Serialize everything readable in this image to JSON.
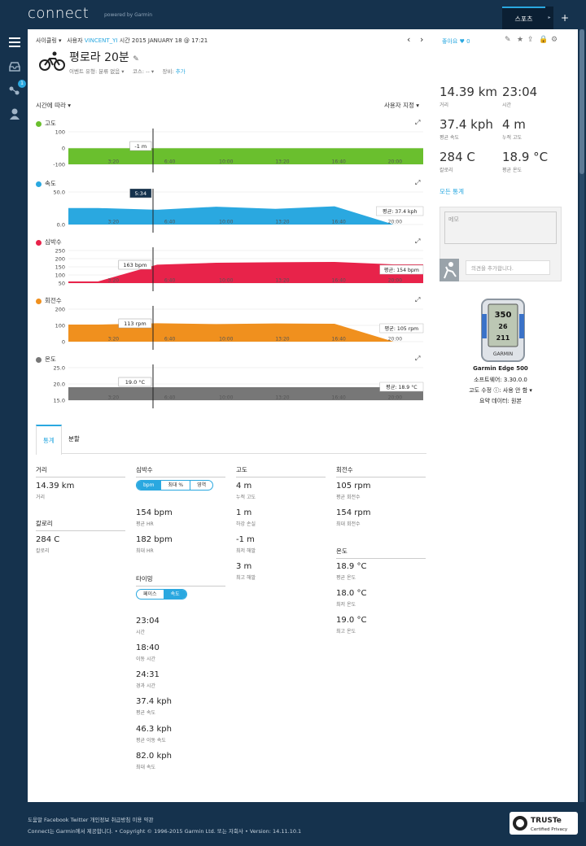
{
  "header": {
    "logo": "connect",
    "powered_by": "powered by Garmin",
    "sport_tab": "스포츠",
    "tab_menu": "▸",
    "add_tab": "+"
  },
  "leftnav": {
    "badge": "1"
  },
  "breadcrumb": {
    "activity_type": "사이클링 ▾",
    "user_label": "사용자",
    "user": "VINCENT_YI",
    "time_label": "시간",
    "date": "2015 JANUARY 18 @ 17:21"
  },
  "pager": {
    "prev": "‹",
    "next": "›"
  },
  "like": {
    "label": "좋아요",
    "count": "0"
  },
  "activity": {
    "title": "평로라 20분",
    "event_type_label": "이벤트 유형:",
    "event_type": "분류 없음 ▾",
    "course_label": "코스:",
    "course": "-- ▾",
    "gear_label": "장비:",
    "gear": "추가"
  },
  "chart_controls": {
    "time_select": "시간에 따라 ▾",
    "user_select": "사용자 지정 ▾"
  },
  "chart_data": [
    {
      "type": "area",
      "title": "고도",
      "color": "#6abf2e",
      "x": [
        "3:20",
        "6:40",
        "10:00",
        "13:20",
        "16:40",
        "20:00"
      ],
      "y": [
        -1,
        -1,
        -1,
        -1,
        -1,
        -1
      ],
      "yticks": [
        "100",
        "0",
        "-100"
      ],
      "ylim": [
        -100,
        100
      ],
      "cursor_label": "-1 m"
    },
    {
      "type": "area",
      "title": "속도",
      "color": "#2aa8e0",
      "x": [
        "3:20",
        "6:40",
        "10:00",
        "13:20",
        "16:40",
        "20:00"
      ],
      "y": [
        38,
        34,
        41,
        36,
        42,
        0
      ],
      "yticks": [
        "50.0",
        "0.0"
      ],
      "ylim": [
        0,
        75
      ],
      "cursor_label": "5:34",
      "avg_label": "평균: 37.4 kph"
    },
    {
      "type": "area",
      "title": "심박수",
      "color": "#e8234a",
      "x": [
        "3:20",
        "6:40",
        "10:00",
        "13:20",
        "16:40",
        "20:00"
      ],
      "y": [
        60,
        163,
        175,
        178,
        180,
        165
      ],
      "yticks": [
        "250",
        "200",
        "150",
        "100",
        "50"
      ],
      "ylim": [
        50,
        250
      ],
      "cursor_label": "163 bpm",
      "avg_label": "평균: 154 bpm"
    },
    {
      "type": "area",
      "title": "회전수",
      "color": "#f0901e",
      "x": [
        "3:20",
        "6:40",
        "10:00",
        "13:20",
        "16:40",
        "20:00"
      ],
      "y": [
        105,
        113,
        108,
        112,
        110,
        0
      ],
      "yticks": [
        "200",
        "100",
        "0"
      ],
      "ylim": [
        0,
        200
      ],
      "cursor_label": "113 rpm",
      "avg_label": "평균: 105 rpm"
    },
    {
      "type": "area",
      "title": "온도",
      "color": "#777777",
      "x": [
        "3:20",
        "6:40",
        "10:00",
        "13:20",
        "16:40",
        "20:00"
      ],
      "y": [
        19.0,
        19.0,
        19.0,
        19.0,
        19.0,
        19.0
      ],
      "yticks": [
        "25.0",
        "20.0",
        "15.0"
      ],
      "ylim": [
        15,
        25
      ],
      "cursor_label": "19.0 °C",
      "avg_label": "평균: 18.9 °C"
    }
  ],
  "summary": {
    "distance": {
      "value": "14.39 km",
      "label": "거리"
    },
    "time": {
      "value": "23:04",
      "label": "시간"
    },
    "avg_speed": {
      "value": "37.4 kph",
      "label": "평균 속도"
    },
    "elev_gain": {
      "value": "4 m",
      "label": "누적 고도"
    },
    "calories": {
      "value": "284 C",
      "label": "칼로리"
    },
    "avg_temp": {
      "value": "18.9 °C",
      "label": "평균 온도"
    },
    "all_stats": "모든 통계"
  },
  "notes": {
    "memo_placeholder": "메모",
    "comment_placeholder": "의견을 추가합니다."
  },
  "device": {
    "screen_top": "350",
    "screen_mid": "26",
    "screen_bot": "211",
    "brand": "GARMIN",
    "name": "Garmin Edge 500",
    "firmware": "소프트웨어: 3.30.0.0",
    "elev_correction": "고도 수정 ⓘ: 사용 안 함 ▾",
    "summary_data": "요약 데이터: 원본"
  },
  "tabs": {
    "stats": "통계",
    "splits": "분할"
  },
  "stats": {
    "distance_h": "거리",
    "distance_v": "14.39 km",
    "distance_l": "거리",
    "calories_h": "칼로리",
    "calories_v": "284 C",
    "calories_l": "칼로리",
    "hr_h": "심박수",
    "hr_toggle": [
      "bpm",
      "최대 %",
      "영역"
    ],
    "hr_avg_v": "154 bpm",
    "hr_avg_l": "평균 HR",
    "hr_max_v": "182 bpm",
    "hr_max_l": "최대 HR",
    "timing_h": "타이밍",
    "timing_toggle": [
      "페이스",
      "속도"
    ],
    "t1_v": "23:04",
    "t1_l": "시간",
    "t2_v": "18:40",
    "t2_l": "이동 시간",
    "t3_v": "24:31",
    "t3_l": "경과 시간",
    "t4_v": "37.4 kph",
    "t4_l": "평균 속도",
    "t5_v": "46.3 kph",
    "t5_l": "평균 이동 속도",
    "t6_v": "82.0 kph",
    "t6_l": "최대 속도",
    "elev_h": "고도",
    "e1_v": "4 m",
    "e1_l": "누적 고도",
    "e2_v": "1 m",
    "e2_l": "하강 손실",
    "e3_v": "-1 m",
    "e3_l": "최저 해발",
    "e4_v": "3 m",
    "e4_l": "최고 해발",
    "cad_h": "회전수",
    "c1_v": "105 rpm",
    "c1_l": "평균 회전수",
    "c2_v": "154 rpm",
    "c2_l": "최대 회전수",
    "temp_h": "온도",
    "tp1_v": "18.9 °C",
    "tp1_l": "평균 온도",
    "tp2_v": "18.0 °C",
    "tp2_l": "최저 온도",
    "tp3_v": "19.0 °C",
    "tp3_l": "최고 온도"
  },
  "footer": {
    "links": "도움말 Facebook Twitter 개인정보 취급방침 이용 약관",
    "copyright": "Connect는 Garmin에서 제공합니다. • Copyright © 1996-2015 Garmin Ltd. 또는 자회사 • Version: 14.11.10.1",
    "truste": "TRUSTe",
    "truste_sub": "Certified Privacy"
  }
}
